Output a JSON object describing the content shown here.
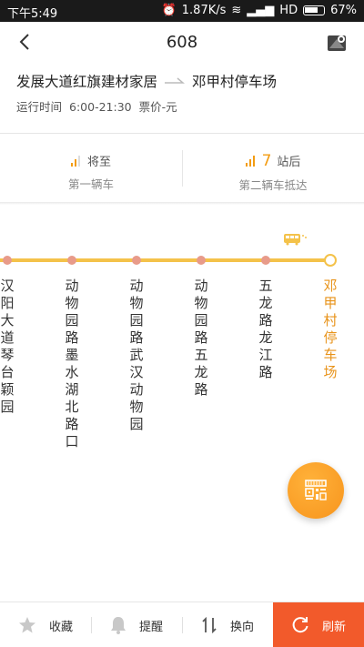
{
  "status_bar": {
    "time": "下午5:49",
    "net_speed": "1.87K/s",
    "network": "HD",
    "battery": "67%"
  },
  "header": {
    "title": "608"
  },
  "route": {
    "from": "发展大道红旗建材家居",
    "to": "邓甲村停车场",
    "hours_label": "运行时间",
    "hours": "6:00-21:30",
    "fare": "票价-元"
  },
  "arrival": {
    "first": {
      "status": "将至",
      "label": "第一辆车"
    },
    "second": {
      "count": "7",
      "unit": "站后",
      "label": "第二辆车抵达"
    }
  },
  "stations": [
    {
      "name": "汉阳大道琴台颖园",
      "active": false
    },
    {
      "name": "动物园路墨水湖北路口",
      "active": false
    },
    {
      "name": "动物园路武汉动物园",
      "active": false
    },
    {
      "name": "动物园路五龙路",
      "active": false
    },
    {
      "name": "五龙路龙江路",
      "active": false
    },
    {
      "name": "邓甲村停车场",
      "active": true
    }
  ],
  "bottom_bar": {
    "favorite": "收藏",
    "remind": "提醒",
    "reverse": "换向",
    "refresh": "刷新"
  },
  "colors": {
    "accent": "#f7941d",
    "line": "#f4c24a",
    "refresh": "#f25a2b",
    "station_dot": "#e89b8a"
  }
}
